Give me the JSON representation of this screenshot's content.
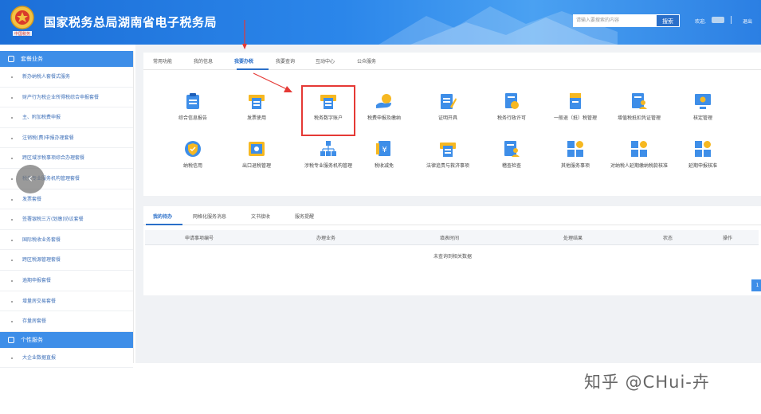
{
  "header": {
    "site_title": "国家税务总局湖南省电子税务局",
    "emblem_text": "中国税务",
    "search_placeholder": "请输入要搜索的内容",
    "search_button": "搜索",
    "welcome": "欢迎,",
    "logout": "退出",
    "colors": {
      "brand": "#2b86ea",
      "accent": "#2a6fc9"
    }
  },
  "sidebar": {
    "section1": "套餐业务",
    "items": [
      "新办纳税人套餐式服务",
      "财产行为税企业所得税综合申报套餐",
      "主、附加税费申报",
      "注销税(费)申报办理套餐",
      "跨区域涉税事项综合办理套餐",
      "税务专业服务机构管理套餐",
      "发票套餐",
      "签署银税三方(划缴)协议套餐",
      "国际税收业务套餐",
      "跨区税源管理套餐",
      "逾期申报套餐",
      "增量房交易套餐",
      "存量房套餐"
    ],
    "section2": "个性服务",
    "items2": [
      "大企业数据直报"
    ],
    "collapse_icon": "‹"
  },
  "main": {
    "tabs": [
      "常用功能",
      "我的信息",
      "我要办税",
      "我要查询",
      "互动中心",
      "公众服务"
    ],
    "active_tab": "我要办税",
    "functions": [
      {
        "label": "综合信息报告",
        "icon": "clipboard-icon"
      },
      {
        "label": "发票使用",
        "icon": "invoice-printer-icon"
      },
      {
        "label": "税务数字账户",
        "icon": "digital-account-icon"
      },
      {
        "label": "税费申报及缴纳",
        "icon": "hand-coin-icon"
      },
      {
        "label": "证明开具",
        "icon": "certificate-pen-icon"
      },
      {
        "label": "税务行政许可",
        "icon": "license-badge-icon"
      },
      {
        "label": "一般退（抵）税管理",
        "icon": "refund-book-icon"
      },
      {
        "label": "增值税抵扣凭证管理",
        "icon": "voucher-person-icon"
      },
      {
        "label": "核定管理",
        "icon": "monitor-gear-icon"
      },
      {
        "label": "纳税信用",
        "icon": "credit-shield-icon"
      },
      {
        "label": "出口退税管理",
        "icon": "export-refund-icon"
      },
      {
        "label": "涉税专业服务机构管理",
        "icon": "org-chart-icon"
      },
      {
        "label": "税收减免",
        "icon": "yen-doc-icon"
      },
      {
        "label": "法律追责与救济事项",
        "icon": "law-doc-icon"
      },
      {
        "label": "稽查检查",
        "icon": "inspection-person-icon"
      },
      {
        "label": "其他服务事项",
        "icon": "grid-tiles-icon"
      },
      {
        "label": "对纳税人延期缴纳税款核准",
        "icon": "grid-tiles-icon"
      },
      {
        "label": "延期申报核准",
        "icon": "grid-tiles-icon"
      }
    ]
  },
  "todo": {
    "tabs": [
      "我的待办",
      "网格化服务消息",
      "文书接收",
      "服务提醒"
    ],
    "columns": [
      "申请事项编号",
      "办理业务",
      "填表时间",
      "处理结果",
      "状态",
      "操作"
    ],
    "empty": "未查询到相关数据",
    "page": "1"
  },
  "watermark": "知乎 @CHui-卉"
}
